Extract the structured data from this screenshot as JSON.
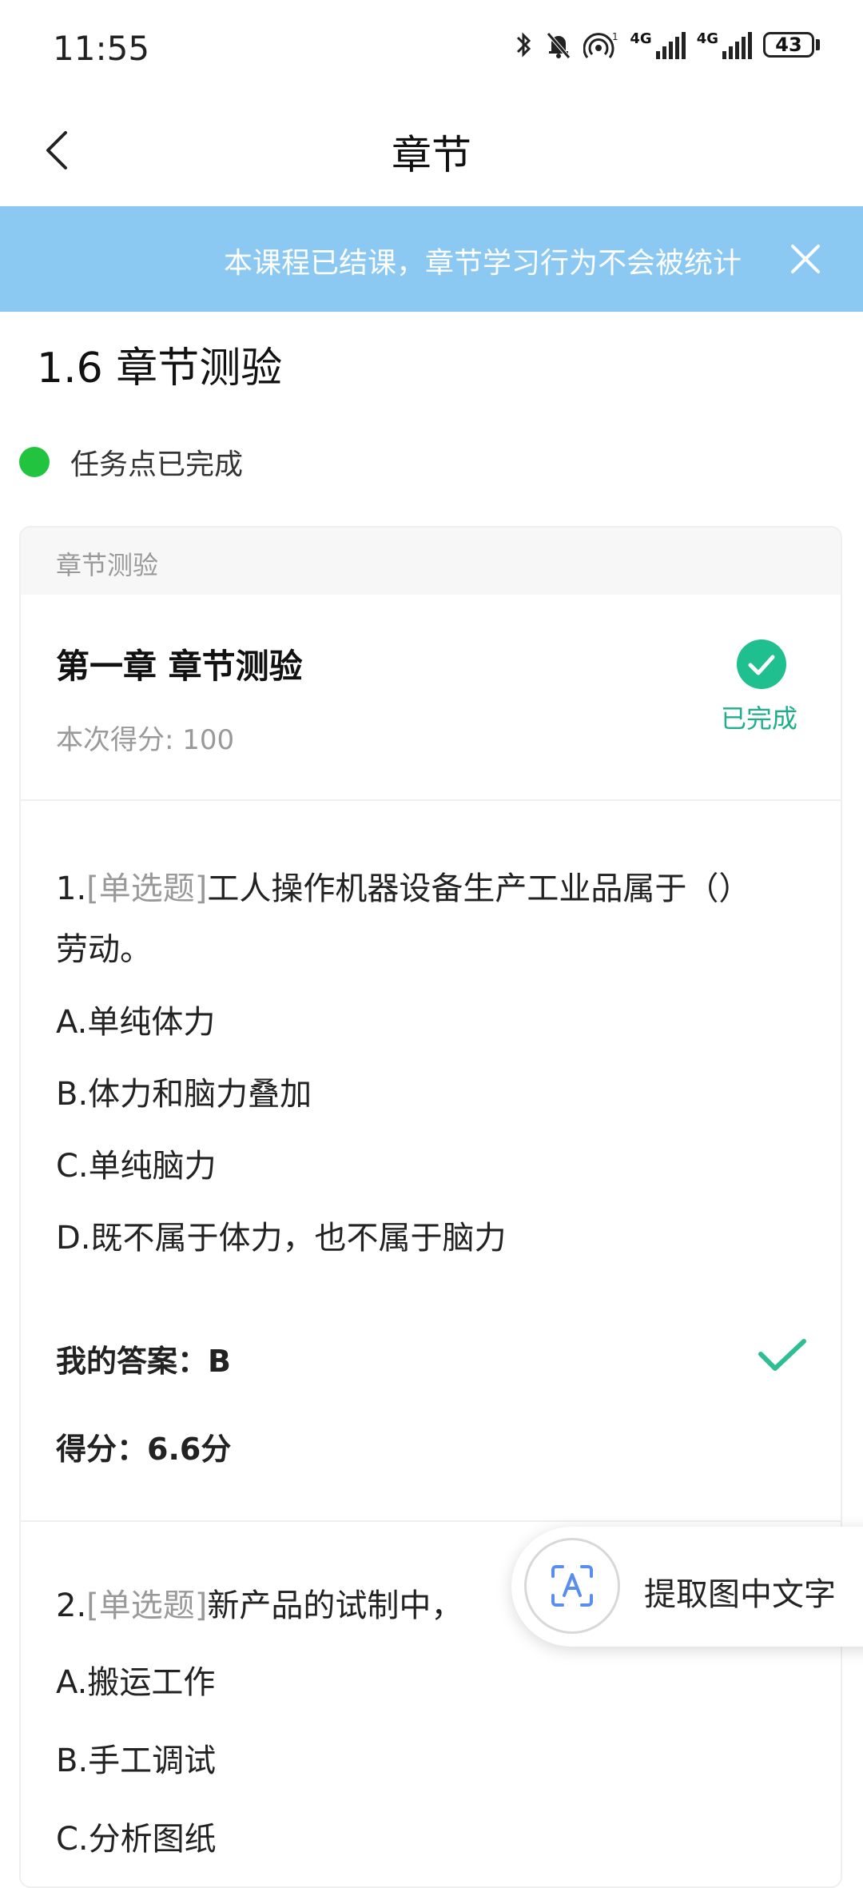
{
  "status_bar": {
    "time": "11:55",
    "battery": "43",
    "network_1": "4G",
    "network_2": "4G",
    "hotspot_sup": "1"
  },
  "nav": {
    "title": "章节"
  },
  "notice": {
    "text": "本课程已结课，章节学习行为不会被统计"
  },
  "section": {
    "title": "1.6 章节测验",
    "task_status": "任务点已完成"
  },
  "card": {
    "header": "章节测验",
    "quiz_title": "第一章 章节测验",
    "quiz_score": "本次得分: 100",
    "done_label": "已完成"
  },
  "questions": [
    {
      "number": "1.",
      "type": "[单选题]",
      "text": "工人操作机器设备生产工业品属于（）劳动。",
      "options": [
        "A.单纯体力",
        "B.体力和脑力叠加",
        "C.单纯脑力",
        "D.既不属于体力，也不属于脑力"
      ],
      "my_answer": "我的答案：B",
      "score": "得分：6.6分"
    },
    {
      "number": "2.",
      "type": "[单选题]",
      "text": "新产品的试制中，",
      "options": [
        "A.搬运工作",
        "B.手工调试",
        "C.分析图纸"
      ]
    }
  ],
  "ocr_button": {
    "label": "提取图中文字"
  },
  "colors": {
    "notice_bg": "#8cc9f2",
    "task_dot": "#22c33f",
    "success": "#1fae8c"
  }
}
